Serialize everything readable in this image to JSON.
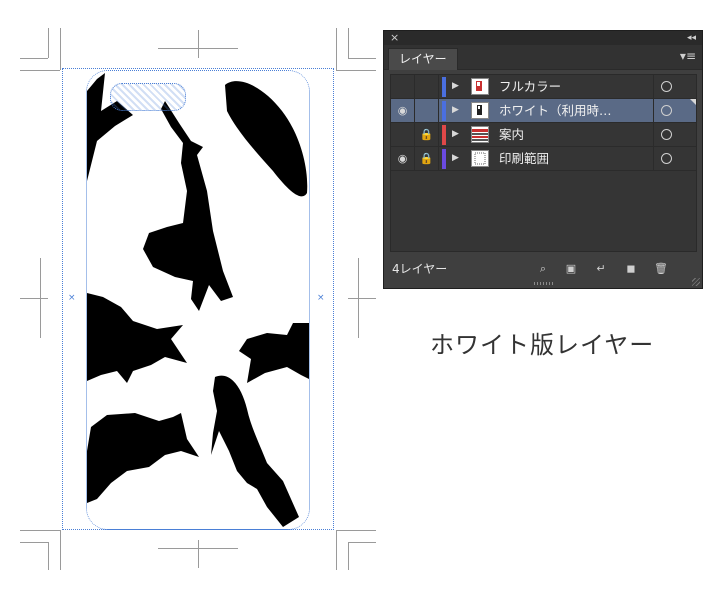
{
  "panel": {
    "close_glyph": "×",
    "collapse_glyph": "◂◂",
    "tab_label": "レイヤー",
    "menu_glyph": "▾≡",
    "layers": [
      {
        "name": "フルカラー",
        "visible": false,
        "locked": false,
        "color": "#4a6fe0",
        "selected": false
      },
      {
        "name": "ホワイト（利用時…",
        "visible": true,
        "locked": false,
        "color": "#4a6fe0",
        "selected": true
      },
      {
        "name": "案内",
        "visible": false,
        "locked": true,
        "color": "#e04848",
        "selected": false
      },
      {
        "name": "印刷範囲",
        "visible": true,
        "locked": true,
        "color": "#6a4ae0",
        "selected": false
      }
    ],
    "layer_count": "4レイヤー",
    "icons": {
      "eye": "◉",
      "lock": "🔒",
      "expand": "▶",
      "search": "⌕",
      "clipping_mask": "▣",
      "new_sublayer": "↵",
      "new_layer": "◼",
      "delete": "🗑"
    }
  },
  "caption": "ホワイト版レイヤー"
}
